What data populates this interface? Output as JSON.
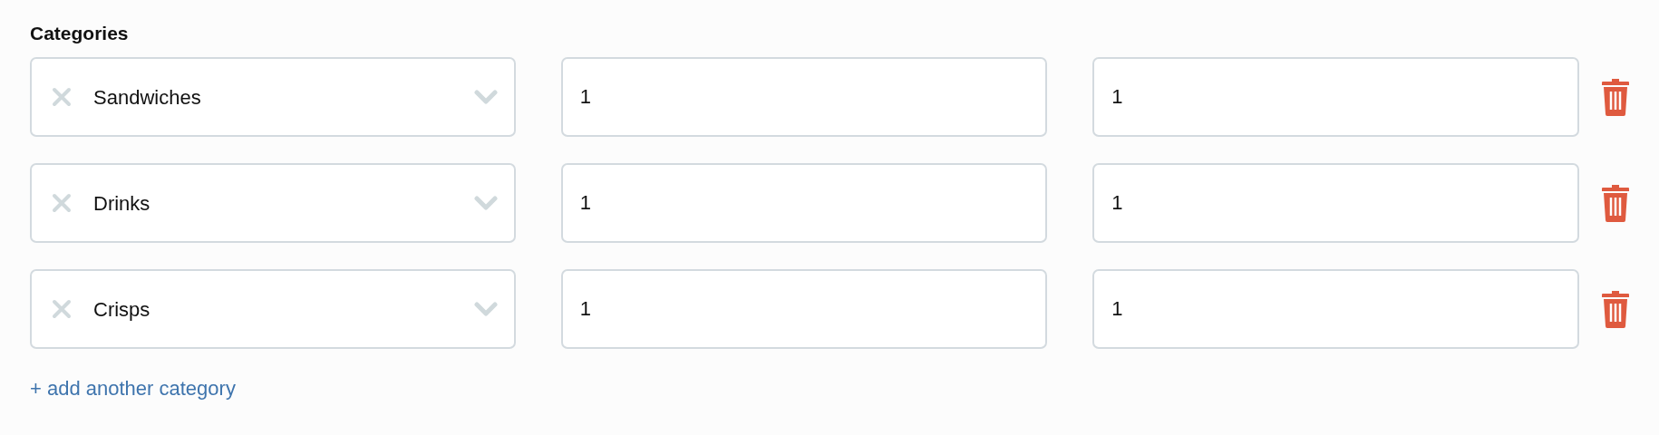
{
  "heading": "Categories",
  "rows": [
    {
      "category": "Sandwiches",
      "value_1": "1",
      "value_2": "1"
    },
    {
      "category": "Drinks",
      "value_1": "1",
      "value_2": "1"
    },
    {
      "category": "Crisps",
      "value_1": "1",
      "value_2": "1"
    }
  ],
  "add_link": "+ add another category"
}
